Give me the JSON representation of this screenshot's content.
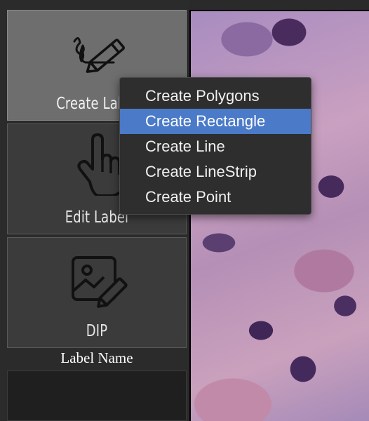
{
  "sidebar": {
    "tools": [
      {
        "label": "Create Label",
        "icon": "pencil-scribble-icon",
        "active": true
      },
      {
        "label": "Edit Label",
        "icon": "hand-pointer-icon",
        "active": false
      },
      {
        "label": "DIP",
        "icon": "image-edit-icon",
        "active": false
      }
    ],
    "label_name_heading": "Label Name"
  },
  "context_menu": {
    "items": [
      {
        "label": "Create Polygons",
        "selected": false
      },
      {
        "label": "Create Rectangle",
        "selected": true
      },
      {
        "label": "Create Line",
        "selected": false
      },
      {
        "label": "Create LineStrip",
        "selected": false
      },
      {
        "label": "Create Point",
        "selected": false
      }
    ],
    "highlight_color": "#4a7ac8"
  },
  "canvas": {
    "content": "microscopy-tissue-image"
  }
}
